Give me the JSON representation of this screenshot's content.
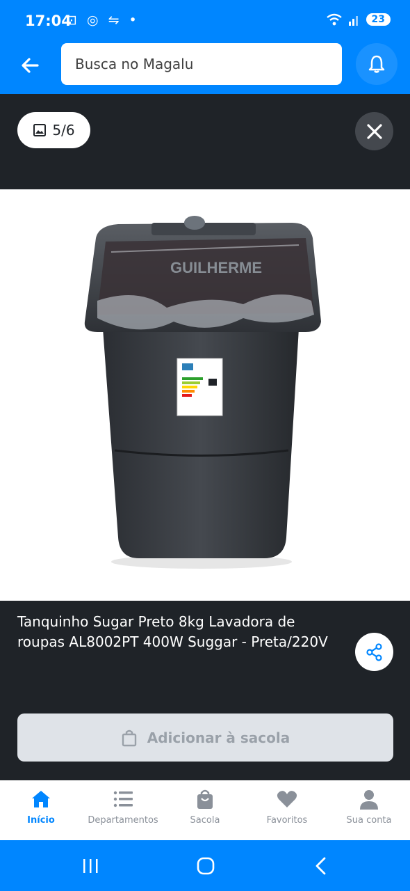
{
  "status_bar": {
    "time": "17:04",
    "notif_icons": "⊡ ◎ ⇋ •",
    "battery": "23"
  },
  "header": {
    "search_placeholder": "Busca no Magalu"
  },
  "gallery": {
    "counter": "5/6",
    "image_alt": "Tanquinho preto com tampa envolta em plástico",
    "watermark": "GUILHERME"
  },
  "product": {
    "title": "Tanquinho Sugar Preto 8kg Lavadora de roupas AL8002PT 400W Suggar - Preta/220V",
    "add_button_label": "Adicionar à sacola"
  },
  "nav": {
    "items": [
      {
        "label": "Início",
        "icon": "home-icon",
        "active": true
      },
      {
        "label": "Departamentos",
        "icon": "menu-icon",
        "active": false
      },
      {
        "label": "Sacola",
        "icon": "bag-icon",
        "active": false
      },
      {
        "label": "Favoritos",
        "icon": "heart-icon",
        "active": false
      },
      {
        "label": "Sua conta",
        "icon": "user-icon",
        "active": false
      }
    ]
  },
  "colors": {
    "brand": "#0086ff",
    "dark_bg": "#1f2328",
    "disabled_btn": "#dfe3e8"
  }
}
